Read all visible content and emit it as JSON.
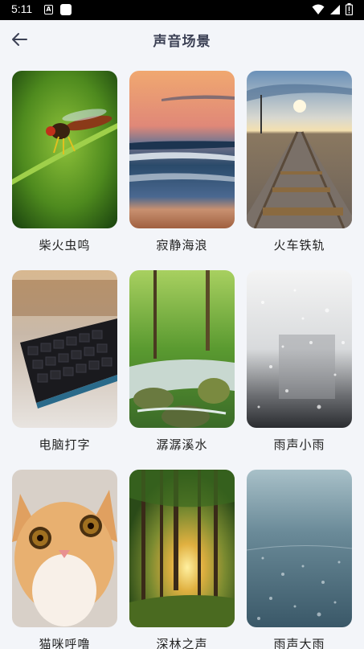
{
  "status_bar": {
    "time": "5:11",
    "notification_icon_label": "A"
  },
  "header": {
    "title": "声音场景"
  },
  "scenes": [
    {
      "label": "柴火虫鸣"
    },
    {
      "label": "寂静海浪"
    },
    {
      "label": "火车铁轨"
    },
    {
      "label": "电脑打字"
    },
    {
      "label": "潺潺溪水"
    },
    {
      "label": "雨声小雨"
    },
    {
      "label": "猫咪呼噜"
    },
    {
      "label": "深林之声"
    },
    {
      "label": "雨声大雨"
    }
  ]
}
